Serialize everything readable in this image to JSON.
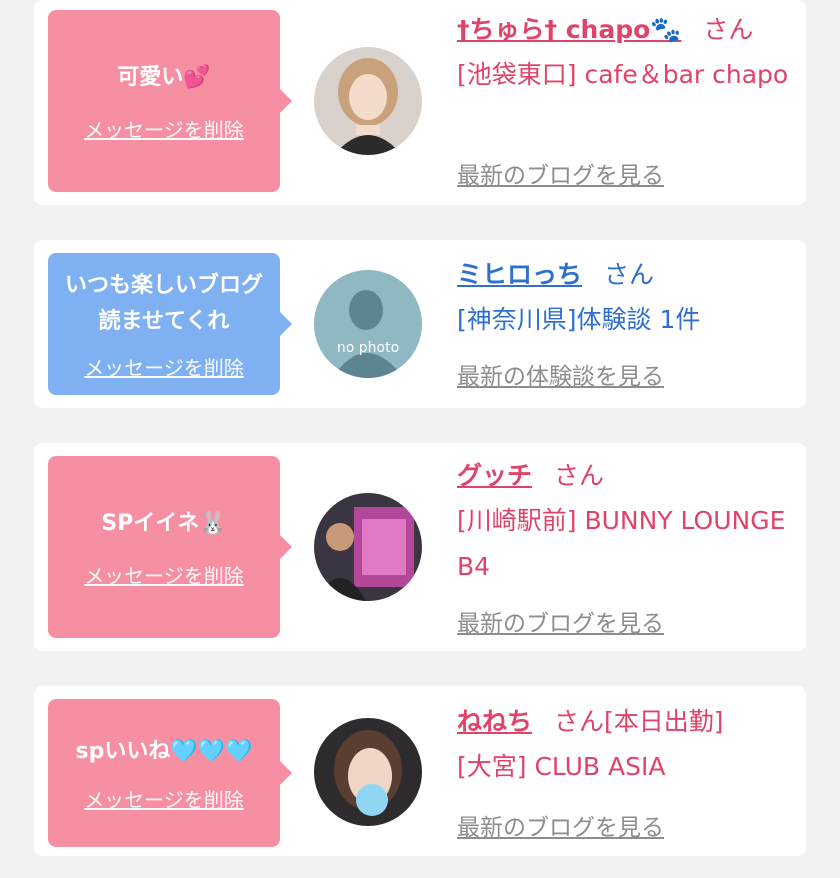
{
  "items": [
    {
      "message": "可愛い💕",
      "delete_label": "メッセージを削除",
      "name": "†ちゅら† chapo🐾",
      "honorific": "さん",
      "shop": "[池袋東口] cafe＆bar chapo",
      "latest_link": "最新のブログを見る",
      "avatar_icon": "user-photo"
    },
    {
      "message": "いつも楽しいブログ読ませてくれ",
      "delete_label": "メッセージを削除",
      "name": "ミヒロっち",
      "honorific": "さん",
      "shop": "[神奈川県]体験談 1件",
      "latest_link": "最新の体験談を見る",
      "avatar_text": "no photo",
      "avatar_icon": "no-photo-silhouette"
    },
    {
      "message": "SPイイネ🐰",
      "delete_label": "メッセージを削除",
      "name": "グッチ",
      "honorific": "さん",
      "shop": "[川崎駅前] BUNNY LOUNGE B4",
      "latest_link": "最新のブログを見る",
      "avatar_icon": "user-photo"
    },
    {
      "message": "spいいね🩵🩵🩵",
      "delete_label": "メッセージを削除",
      "name": "ねねち",
      "honorific": "さん[本日出勤]",
      "shop": "[大宮] CLUB ASIA",
      "latest_link": "最新のブログを見る",
      "avatar_icon": "user-photo"
    }
  ],
  "colors": {
    "pink_bubble": "#f78fa2",
    "blue_bubble": "#7fb0f1",
    "pink_text": "#e0436a",
    "blue_text": "#2f6fd0",
    "link_gray": "#8d8d8d"
  }
}
